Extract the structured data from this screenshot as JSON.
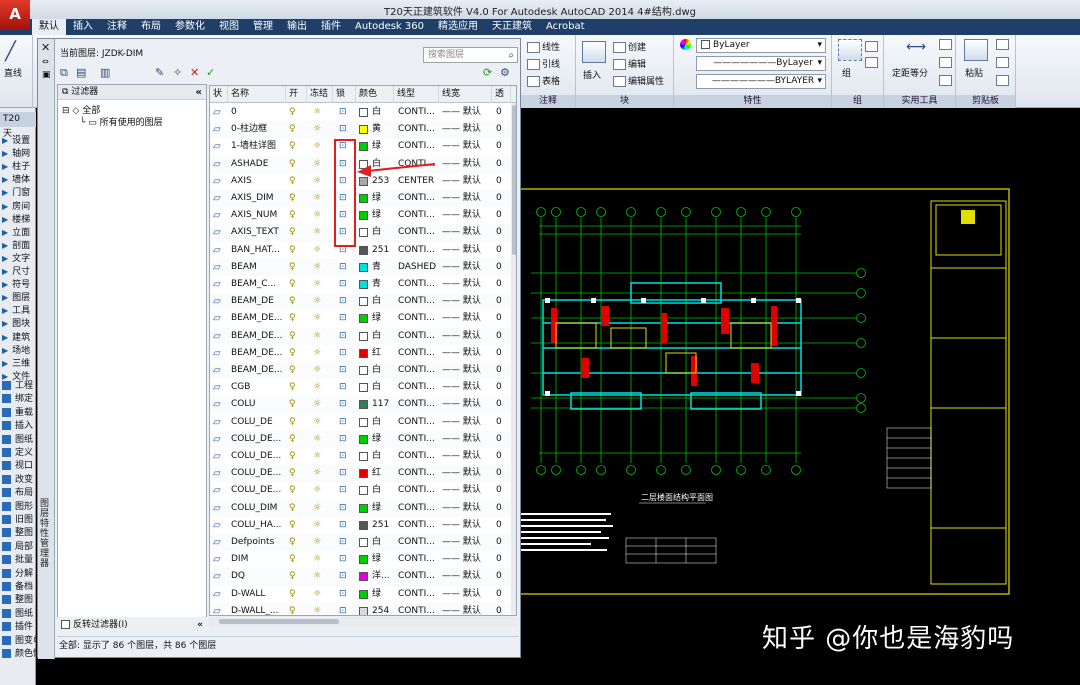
{
  "window": {
    "title": "T20天正建筑软件 V4.0 For Autodesk AutoCAD 2014    4#结构.dwg",
    "logo": "A"
  },
  "tabs": [
    "默认",
    "插入",
    "注释",
    "布局",
    "参数化",
    "视图",
    "管理",
    "输出",
    "插件",
    "Autodesk 360",
    "精选应用",
    "天正建筑",
    "Acrobat"
  ],
  "ribbon": {
    "draw_label": "直线",
    "block_items": [
      "插入",
      "创建",
      "编辑",
      "编辑属性"
    ],
    "linetype_items": [
      "线性",
      "引线",
      "表格"
    ],
    "block_label": "块",
    "props_label": "特性",
    "props_values": [
      "ByLayer",
      "ByLayer",
      "BYLAYER"
    ],
    "group_label": "组",
    "group_item": "组",
    "utils_item": "定距等分",
    "utils_label": "实用工具",
    "clip_item": "粘贴",
    "clip_label": "剪贴板",
    "notes_label": "注释"
  },
  "left_palette": {
    "header": "T20天...",
    "items": [
      "设置",
      "轴网",
      "柱子",
      "墙体",
      "门窗",
      "房间",
      "楼梯",
      "立面",
      "剖面",
      "文字",
      "尺寸",
      "符号",
      "图层",
      "工具",
      "图块",
      "建筑",
      "场地",
      "三维",
      "文件"
    ],
    "tools": [
      "工程",
      "绑定",
      "重载",
      "插入",
      "图纸",
      "定义",
      "视口",
      "改变",
      "布局",
      "图形",
      "旧图",
      "整图",
      "局部",
      "批量",
      "分解",
      "备档",
      "整图",
      "图纸",
      "插件",
      "图变单色",
      "颜色恢复"
    ]
  },
  "layer_manager": {
    "current_layer": "当前图层: JZDK-DIM",
    "search_placeholder": "搜索图层",
    "filter_header": "过滤器",
    "tree_root": "全部",
    "tree_child": "所有使用的图层",
    "invert_filter": "反转过滤器(I)",
    "vertical_title": "图层特性管理器",
    "status": "全部: 显示了 86 个图层，共 86 个图层",
    "columns": [
      "状",
      "名称",
      "开",
      "冻结",
      "锁",
      "颜色",
      "线型",
      "线宽",
      "透"
    ],
    "rows": [
      {
        "name": "0",
        "color_name": "白",
        "hex": "#ffffff",
        "linetype": "CONTI...",
        "lineweight": "—— 默认",
        "trans": "0"
      },
      {
        "name": "0-柱边框",
        "color_name": "黄",
        "hex": "#ffff00",
        "linetype": "CONTI...",
        "lineweight": "—— 默认",
        "trans": "0"
      },
      {
        "name": "1-墙柱详图",
        "color_name": "绿",
        "hex": "#00d000",
        "linetype": "CONTI...",
        "lineweight": "—— 默认",
        "trans": "0"
      },
      {
        "name": "ASHADE",
        "color_name": "白",
        "hex": "#ffffff",
        "linetype": "CONTI...",
        "lineweight": "—— 默认",
        "trans": "0"
      },
      {
        "name": "AXIS",
        "color_name": "253",
        "hex": "#a8a8a8",
        "linetype": "CENTER",
        "lineweight": "—— 默认",
        "trans": "0"
      },
      {
        "name": "AXIS_DIM",
        "color_name": "绿",
        "hex": "#00d000",
        "linetype": "CONTI...",
        "lineweight": "—— 默认",
        "trans": "0"
      },
      {
        "name": "AXIS_NUM",
        "color_name": "绿",
        "hex": "#00d000",
        "linetype": "CONTI...",
        "lineweight": "—— 默认",
        "trans": "0"
      },
      {
        "name": "AXIS_TEXT",
        "color_name": "白",
        "hex": "#ffffff",
        "linetype": "CONTI...",
        "lineweight": "—— 默认",
        "trans": "0"
      },
      {
        "name": "BAN_HAT...",
        "color_name": "251",
        "hex": "#555555",
        "linetype": "CONTI...",
        "lineweight": "—— 默认",
        "trans": "0"
      },
      {
        "name": "BEAM",
        "color_name": "青",
        "hex": "#00e0e0",
        "linetype": "DASHED",
        "lineweight": "—— 默认",
        "trans": "0"
      },
      {
        "name": "BEAM_C...",
        "color_name": "青",
        "hex": "#00e0e0",
        "linetype": "CONTI...",
        "lineweight": "—— 默认",
        "trans": "0"
      },
      {
        "name": "BEAM_DE",
        "color_name": "白",
        "hex": "#ffffff",
        "linetype": "CONTI...",
        "lineweight": "—— 默认",
        "trans": "0"
      },
      {
        "name": "BEAM_DE...",
        "color_name": "绿",
        "hex": "#00d000",
        "linetype": "CONTI...",
        "lineweight": "—— 默认",
        "trans": "0"
      },
      {
        "name": "BEAM_DE...",
        "color_name": "白",
        "hex": "#ffffff",
        "linetype": "CONTI...",
        "lineweight": "—— 默认",
        "trans": "0"
      },
      {
        "name": "BEAM_DE...",
        "color_name": "红",
        "hex": "#e00000",
        "linetype": "CONTI...",
        "lineweight": "—— 默认",
        "trans": "0"
      },
      {
        "name": "BEAM_DE...",
        "color_name": "白",
        "hex": "#ffffff",
        "linetype": "CONTI...",
        "lineweight": "—— 默认",
        "trans": "0"
      },
      {
        "name": "CGB",
        "color_name": "白",
        "hex": "#ffffff",
        "linetype": "CONTI...",
        "lineweight": "—— 默认",
        "trans": "0"
      },
      {
        "name": "COLU",
        "color_name": "117",
        "hex": "#2f7f5a",
        "linetype": "CONTI...",
        "lineweight": "—— 默认",
        "trans": "0"
      },
      {
        "name": "COLU_DE",
        "color_name": "白",
        "hex": "#ffffff",
        "linetype": "CONTI...",
        "lineweight": "—— 默认",
        "trans": "0"
      },
      {
        "name": "COLU_DE...",
        "color_name": "绿",
        "hex": "#00d000",
        "linetype": "CONTI...",
        "lineweight": "—— 默认",
        "trans": "0"
      },
      {
        "name": "COLU_DE...",
        "color_name": "白",
        "hex": "#ffffff",
        "linetype": "CONTI...",
        "lineweight": "—— 默认",
        "trans": "0"
      },
      {
        "name": "COLU_DE...",
        "color_name": "红",
        "hex": "#e00000",
        "linetype": "CONTI...",
        "lineweight": "—— 默认",
        "trans": "0"
      },
      {
        "name": "COLU_DE...",
        "color_name": "白",
        "hex": "#ffffff",
        "linetype": "CONTI...",
        "lineweight": "—— 默认",
        "trans": "0"
      },
      {
        "name": "COLU_DIM",
        "color_name": "绿",
        "hex": "#00d000",
        "linetype": "CONTI...",
        "lineweight": "—— 默认",
        "trans": "0"
      },
      {
        "name": "COLU_HA...",
        "color_name": "251",
        "hex": "#555555",
        "linetype": "CONTI...",
        "lineweight": "—— 默认",
        "trans": "0"
      },
      {
        "name": "Defpoints",
        "color_name": "白",
        "hex": "#ffffff",
        "linetype": "CONTI...",
        "lineweight": "—— 默认",
        "trans": "0"
      },
      {
        "name": "DIM",
        "color_name": "绿",
        "hex": "#00d000",
        "linetype": "CONTI...",
        "lineweight": "—— 默认",
        "trans": "0"
      },
      {
        "name": "DQ",
        "color_name": "洋...",
        "hex": "#e000e0",
        "linetype": "CONTI...",
        "lineweight": "—— 默认",
        "trans": "0"
      },
      {
        "name": "D-WALL",
        "color_name": "绿",
        "hex": "#00d000",
        "linetype": "CONTI...",
        "lineweight": "—— 默认",
        "trans": "0"
      },
      {
        "name": "D-WALL_...",
        "color_name": "254",
        "hex": "#d8d8d8",
        "linetype": "CONTI...",
        "lineweight": "—— 默认",
        "trans": "0"
      }
    ]
  },
  "drawing": {
    "plan_title": "二层楼面结构平面图"
  },
  "watermark": "知乎 @你也是海豹吗"
}
